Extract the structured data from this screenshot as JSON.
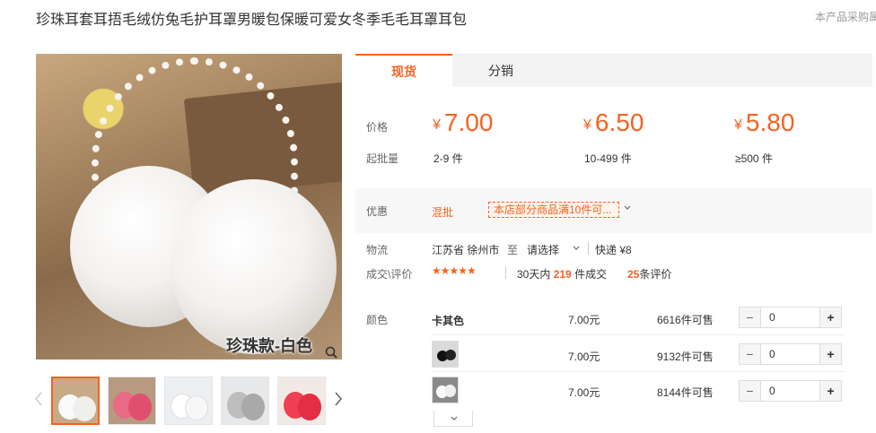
{
  "product": {
    "title": "珍珠耳套耳捂毛绒仿兔毛护耳罩男暖包保暖可爱女冬季毛毛耳罩耳包",
    "corner_note": "本产品采购属",
    "watermark": "珍珠款-白色"
  },
  "gallery": {
    "thumbs": [
      "white-earmuff",
      "pink-earmuff",
      "white-earmuff-2",
      "gray-earmuff",
      "red-earmuff"
    ]
  },
  "tabs": [
    {
      "label": "现货",
      "active": true
    },
    {
      "label": "分销",
      "active": false
    }
  ],
  "pricing": {
    "price_label": "价格",
    "moq_label": "起批量",
    "currency": "¥",
    "tiers": [
      {
        "price": "7.00",
        "range": "2-9 件"
      },
      {
        "price": "6.50",
        "range": "10-499 件"
      },
      {
        "price": "5.80",
        "range": "≥500 件"
      }
    ]
  },
  "promotion": {
    "label": "优惠",
    "tag": "混批",
    "text": "本店部分商品满10件可..."
  },
  "logistics": {
    "label": "物流",
    "origin": "江苏省 徐州市",
    "to": "至",
    "destination": "请选择",
    "shipping": "快递 ¥8"
  },
  "reviews": {
    "label": "成交\\评价",
    "stars": "★★★★★",
    "period": "30天内",
    "sold": "219",
    "sold_suffix": "件成交",
    "review_count": "25",
    "review_suffix": "条评价"
  },
  "sku": {
    "label": "颜色",
    "rows": [
      {
        "name": "卡其色",
        "price": "7.00元",
        "stock": "6616件可售",
        "qty": "0"
      },
      {
        "name": "",
        "price": "7.00元",
        "stock": "9132件可售",
        "qty": "0"
      },
      {
        "name": "",
        "price": "7.00元",
        "stock": "8144件可售",
        "qty": "0"
      }
    ],
    "minus": "−",
    "plus": "+"
  },
  "colors": {
    "accent": "#f76120"
  }
}
